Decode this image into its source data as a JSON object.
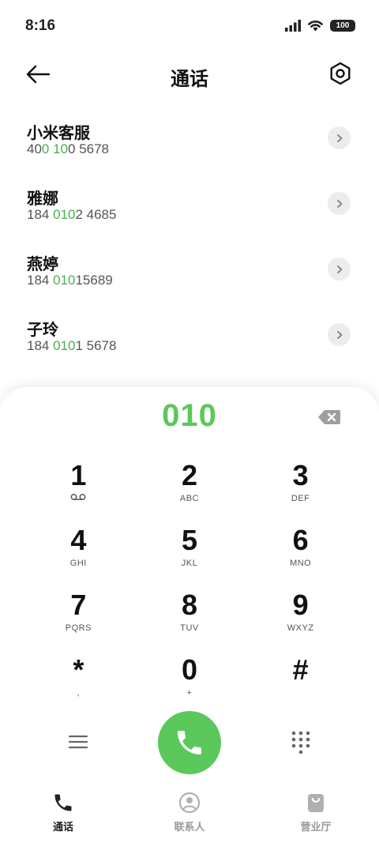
{
  "status_bar": {
    "time": "8:16",
    "battery": "100"
  },
  "header": {
    "title": "通话"
  },
  "contacts": [
    {
      "name": "小米客服",
      "number_parts": [
        "40",
        "0 10",
        "0 5678"
      ]
    },
    {
      "name": "雅娜",
      "number_parts": [
        "184 ",
        "010",
        "2 4685"
      ]
    },
    {
      "name": "燕婷",
      "number_parts": [
        "184 ",
        "010",
        "15689"
      ]
    },
    {
      "name": "子玲",
      "number_parts": [
        "184 ",
        "010",
        "1 5678"
      ]
    }
  ],
  "dialer": {
    "number": "010",
    "keys": [
      {
        "digit": "1",
        "letters": ""
      },
      {
        "digit": "2",
        "letters": "ABC"
      },
      {
        "digit": "3",
        "letters": "DEF"
      },
      {
        "digit": "4",
        "letters": "GHI"
      },
      {
        "digit": "5",
        "letters": "JKL"
      },
      {
        "digit": "6",
        "letters": "MNO"
      },
      {
        "digit": "7",
        "letters": "PQRS"
      },
      {
        "digit": "8",
        "letters": "TUV"
      },
      {
        "digit": "9",
        "letters": "WXYZ"
      },
      {
        "digit": "*",
        "letters": ","
      },
      {
        "digit": "0",
        "letters": "+"
      },
      {
        "digit": "#",
        "letters": ""
      }
    ]
  },
  "bottom_nav": [
    {
      "label": "通话",
      "icon": "phone-icon",
      "active": true
    },
    {
      "label": "联系人",
      "icon": "person-icon",
      "active": false
    },
    {
      "label": "营业厅",
      "icon": "shopping-bag-icon",
      "active": false
    }
  ],
  "colors": {
    "accent": "#5ac85a",
    "highlight": "#4caf50"
  }
}
